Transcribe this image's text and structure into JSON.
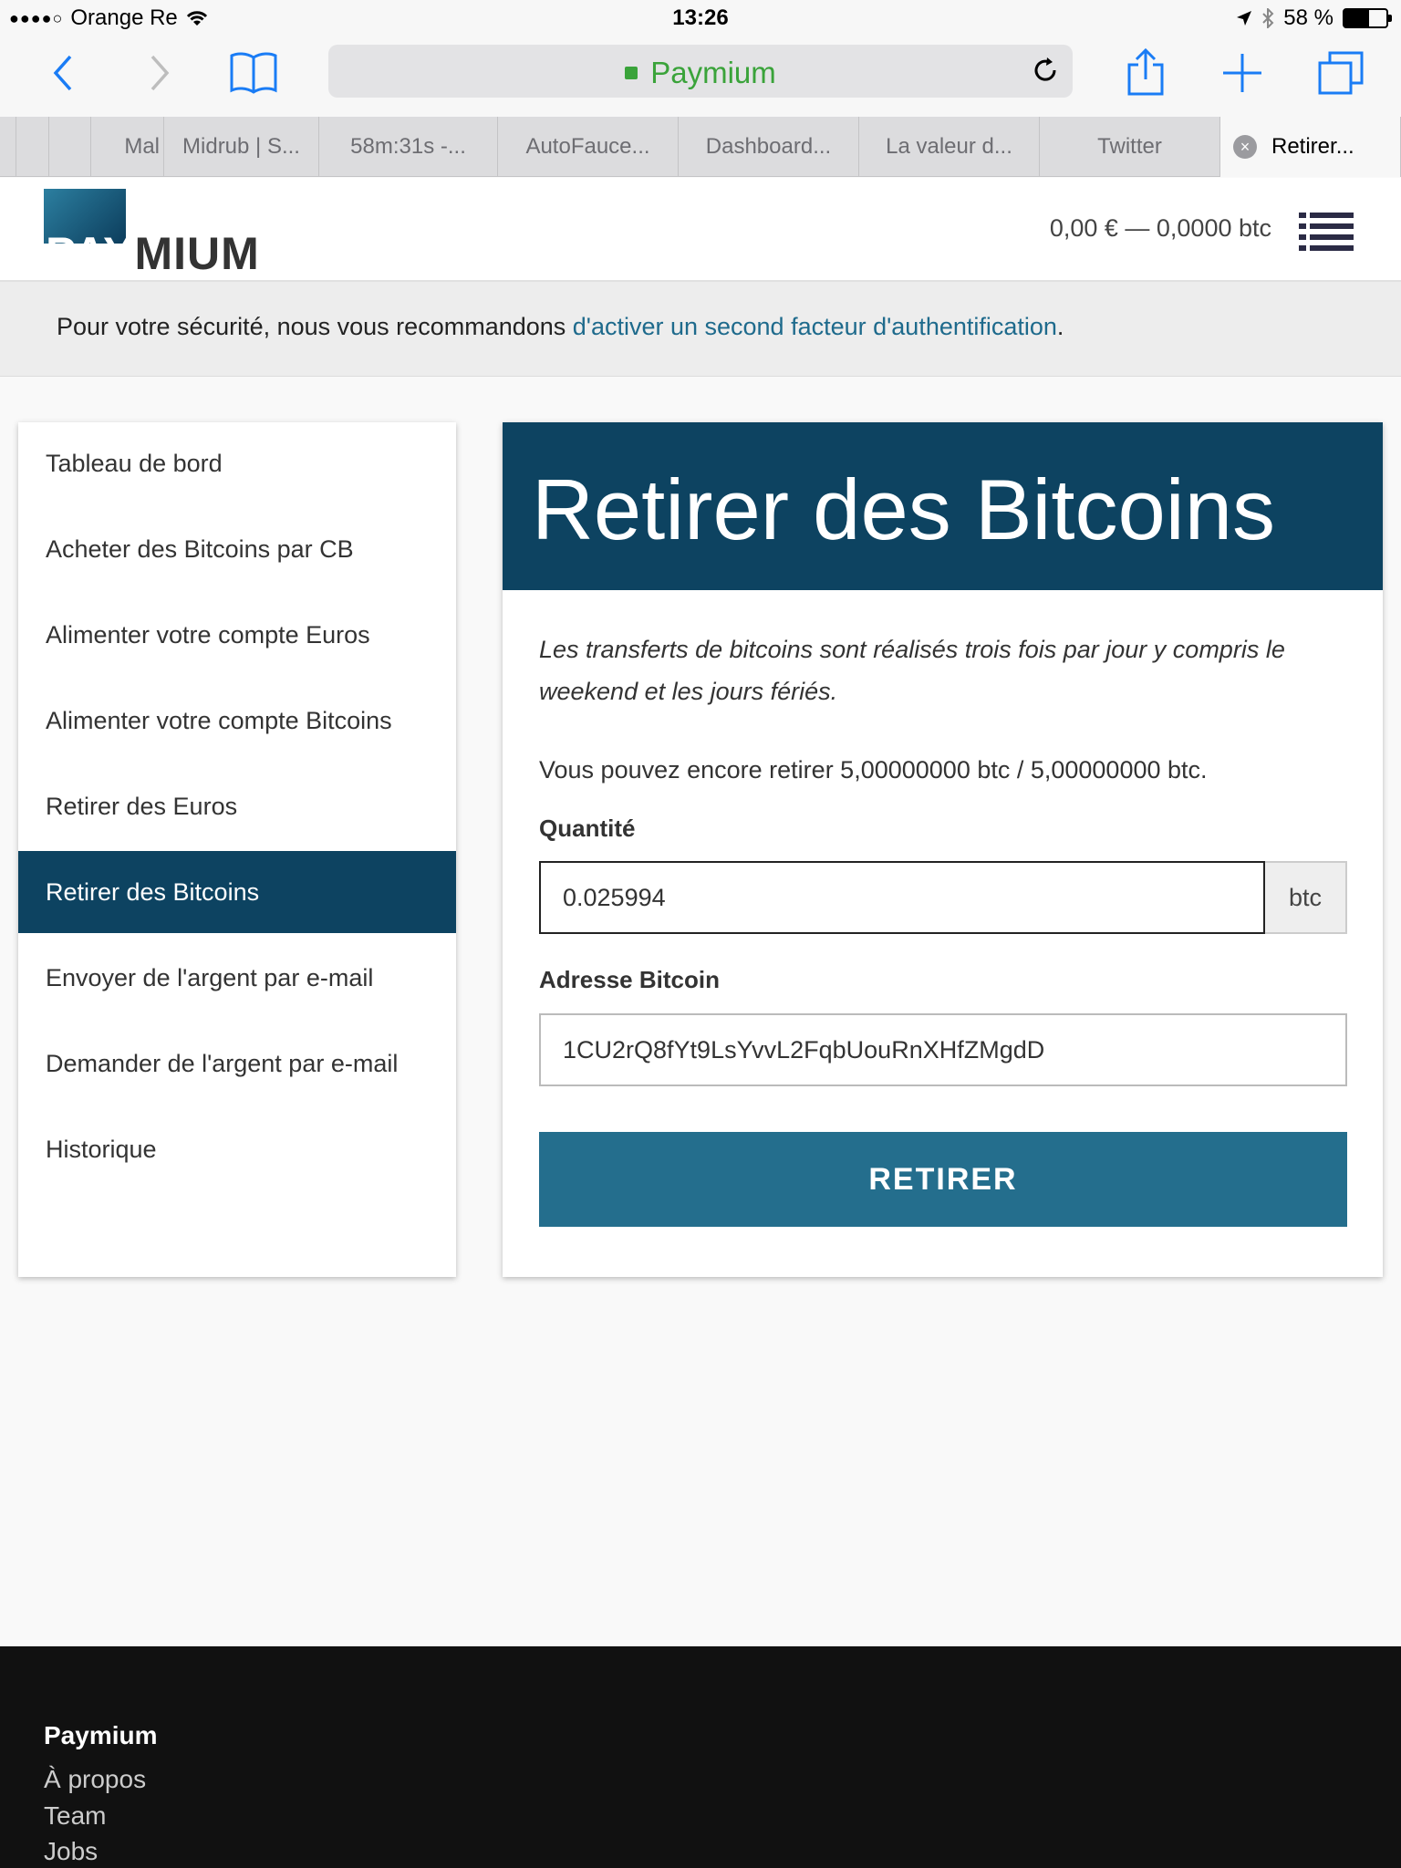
{
  "status_bar": {
    "signal_dots": "●●●●○",
    "carrier": "Orange Re",
    "time": "13:26",
    "battery_text": "58 %",
    "battery_level": 0.58
  },
  "browser": {
    "url_title": "Paymium",
    "tabs": [
      {
        "label": ""
      },
      {
        "label": ""
      },
      {
        "label": ""
      },
      {
        "label": "Mal"
      },
      {
        "label": "Midrub | S..."
      },
      {
        "label": "58m:31s -..."
      },
      {
        "label": "AutoFauce..."
      },
      {
        "label": "Dashboard..."
      },
      {
        "label": "La valeur d..."
      },
      {
        "label": "Twitter"
      },
      {
        "label": "Retirer..."
      }
    ]
  },
  "header": {
    "logo_text_a": "PAY",
    "logo_text_b": "MIUM",
    "balance": "0,00 € — 0,0000 btc"
  },
  "banner": {
    "text_before": "Pour votre sécurité, nous vous recommandons ",
    "link_text": "d'activer un second facteur d'authentification",
    "text_after": "."
  },
  "sidebar": {
    "items": [
      {
        "label": "Tableau de bord"
      },
      {
        "label": "Acheter des Bitcoins par CB"
      },
      {
        "label": "Alimenter votre compte Euros"
      },
      {
        "label": "Alimenter votre compte Bitcoins"
      },
      {
        "label": "Retirer des Euros"
      },
      {
        "label": "Retirer des Bitcoins"
      },
      {
        "label": "Envoyer de l'argent par e-mail"
      },
      {
        "label": "Demander de l'argent par e-mail"
      },
      {
        "label": "Historique"
      }
    ]
  },
  "main": {
    "title": "Retirer des Bitcoins",
    "intro": "Les transferts de bitcoins sont réalisés trois fois par jour y compris le weekend et les jours fériés.",
    "remaining": "Vous pouvez encore retirer 5,00000000 btc / 5,00000000 btc.",
    "quantity_label": "Quantité",
    "quantity_value": "0.025994",
    "quantity_unit": "btc",
    "address_label": "Adresse Bitcoin",
    "address_value": "1CU2rQ8fYt9LsYvvL2FqbUouRnXHfZMgdD",
    "submit_label": "RETIRER"
  },
  "footer": {
    "title": "Paymium",
    "links": [
      {
        "label": "À propos"
      },
      {
        "label": "Team"
      },
      {
        "label": "Jobs"
      }
    ]
  }
}
